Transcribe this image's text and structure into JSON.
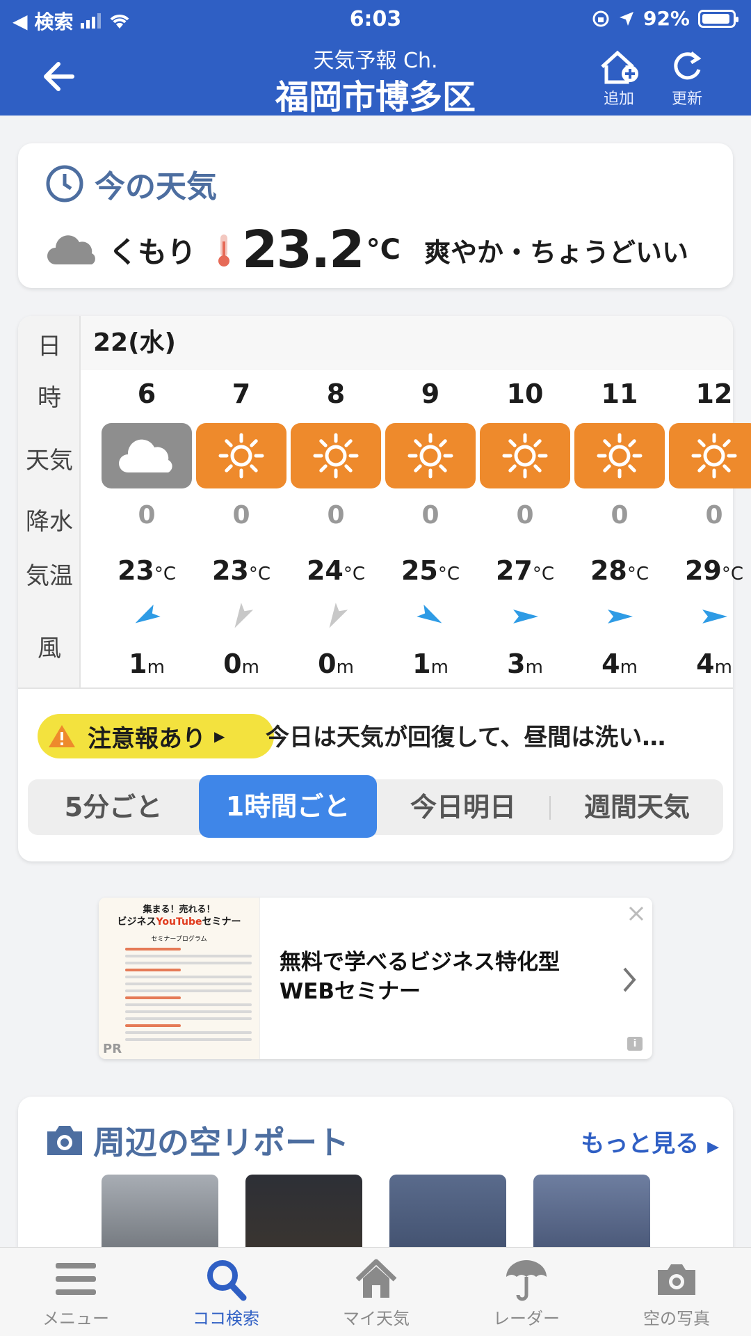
{
  "status": {
    "carrier": "検索",
    "time": "6:03",
    "battery": "92%",
    "battery_level": 0.92
  },
  "header": {
    "subtitle": "天気予報 Ch.",
    "title": "福岡市博多区",
    "add_label": "追加",
    "refresh_label": "更新"
  },
  "now": {
    "title": "今の天気",
    "condition": "くもり",
    "temp": "23.2",
    "unit": "°C",
    "feel": "爽やか・ちょうどいい"
  },
  "forecast": {
    "row_labels": {
      "day": "日",
      "hour": "時",
      "weather": "天気",
      "rain": "降水",
      "temp": "気温",
      "wind": "風"
    },
    "date": "22(水)",
    "hours": [
      {
        "hour": "6",
        "weather": "cloud",
        "rain": "0",
        "temp": "23",
        "wind": "1",
        "dir": "sw-arrow"
      },
      {
        "hour": "7",
        "weather": "sun",
        "rain": "0",
        "temp": "23",
        "wind": "0",
        "dir": "calm"
      },
      {
        "hour": "8",
        "weather": "sun",
        "rain": "0",
        "temp": "24",
        "wind": "0",
        "dir": "calm"
      },
      {
        "hour": "9",
        "weather": "sun",
        "rain": "0",
        "temp": "25",
        "wind": "1",
        "dir": "se-arrow"
      },
      {
        "hour": "10",
        "weather": "sun",
        "rain": "0",
        "temp": "27",
        "wind": "3",
        "dir": "e-arrow"
      },
      {
        "hour": "11",
        "weather": "sun",
        "rain": "0",
        "temp": "28",
        "wind": "4",
        "dir": "e-arrow"
      },
      {
        "hour": "12",
        "weather": "sun",
        "rain": "0",
        "temp": "29",
        "wind": "4",
        "dir": "e-arrow"
      }
    ],
    "temp_unit": "°C",
    "wind_unit": "m"
  },
  "warning": {
    "label": "注意報あり",
    "text": "今日は天気が回復して、昼間は洗い…"
  },
  "tabs": [
    "5分ごと",
    "1時間ごと",
    "今日明日",
    "週間天気"
  ],
  "active_tab": 1,
  "ad": {
    "img_line1": "集まる！売れる！",
    "img_line2a": "ビジネス",
    "img_line2b": "YouTube",
    "img_line2c": "セミナー",
    "img_line3": "セミナープログラム",
    "pr": "PR",
    "text_line1": "無料で学べるビジネス特化型",
    "text_line2": "WEBセミナー",
    "info": "i"
  },
  "sky": {
    "title": "周辺の空リポート",
    "more": "もっと見る"
  },
  "tabbar": [
    {
      "label": "メニュー",
      "icon": "menu-icon"
    },
    {
      "label": "ココ検索",
      "icon": "search-icon",
      "active": true
    },
    {
      "label": "マイ天気",
      "icon": "home-icon"
    },
    {
      "label": "レーダー",
      "icon": "umbrella-icon"
    },
    {
      "label": "空の写真",
      "icon": "camera-icon"
    }
  ],
  "colors": {
    "header": "#2f5fc4",
    "sun": "#ee8a2c",
    "cloud": "#8e8e8e",
    "active_tab": "#3f86e8",
    "warning": "#f3e23e"
  }
}
